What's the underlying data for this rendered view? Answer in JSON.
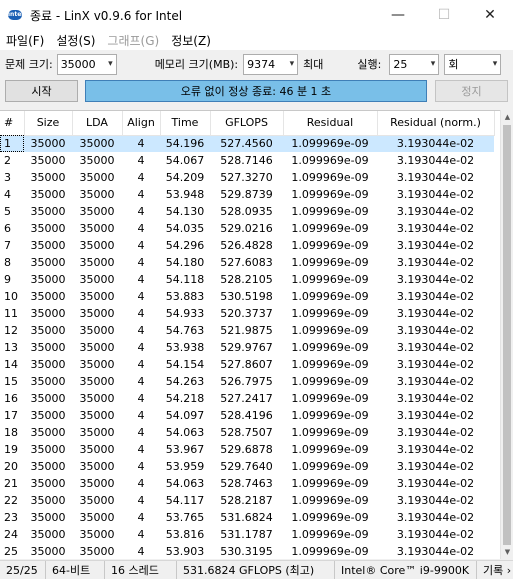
{
  "window": {
    "title": "종료 - LinX v0.9.6 for Intel",
    "app_icon_text": "intel",
    "minimize_glyph": "—",
    "maximize_glyph": "☐",
    "close_glyph": "✕"
  },
  "menu": {
    "file": "파일(F)",
    "settings": "설정(S)",
    "graph": "그래프(G)",
    "info": "정보(Z)"
  },
  "controls": {
    "problem_size_label": "문제 크기:",
    "problem_size_value": "35000",
    "memory_label": "메모리 크기(MB):",
    "memory_value": "9374",
    "max_label": "최대",
    "runs_label": "실행:",
    "runs_value": "25",
    "runs_unit": "회"
  },
  "actions": {
    "start_label": "시작",
    "status_text": "오류 없이 정상 종료: 46 분 1 초",
    "stop_label": "정지"
  },
  "table": {
    "columns": [
      "#",
      "Size",
      "LDA",
      "Align",
      "Time",
      "GFLOPS",
      "Residual",
      "Residual (norm.)"
    ],
    "rows": [
      [
        "1",
        "35000",
        "35000",
        "4",
        "54.196",
        "527.4560",
        "1.099969e-09",
        "3.193044e-02"
      ],
      [
        "2",
        "35000",
        "35000",
        "4",
        "54.067",
        "528.7146",
        "1.099969e-09",
        "3.193044e-02"
      ],
      [
        "3",
        "35000",
        "35000",
        "4",
        "54.209",
        "527.3270",
        "1.099969e-09",
        "3.193044e-02"
      ],
      [
        "4",
        "35000",
        "35000",
        "4",
        "53.948",
        "529.8739",
        "1.099969e-09",
        "3.193044e-02"
      ],
      [
        "5",
        "35000",
        "35000",
        "4",
        "54.130",
        "528.0935",
        "1.099969e-09",
        "3.193044e-02"
      ],
      [
        "6",
        "35000",
        "35000",
        "4",
        "54.035",
        "529.0216",
        "1.099969e-09",
        "3.193044e-02"
      ],
      [
        "7",
        "35000",
        "35000",
        "4",
        "54.296",
        "526.4828",
        "1.099969e-09",
        "3.193044e-02"
      ],
      [
        "8",
        "35000",
        "35000",
        "4",
        "54.180",
        "527.6083",
        "1.099969e-09",
        "3.193044e-02"
      ],
      [
        "9",
        "35000",
        "35000",
        "4",
        "54.118",
        "528.2105",
        "1.099969e-09",
        "3.193044e-02"
      ],
      [
        "10",
        "35000",
        "35000",
        "4",
        "53.883",
        "530.5198",
        "1.099969e-09",
        "3.193044e-02"
      ],
      [
        "11",
        "35000",
        "35000",
        "4",
        "54.933",
        "520.3737",
        "1.099969e-09",
        "3.193044e-02"
      ],
      [
        "12",
        "35000",
        "35000",
        "4",
        "54.763",
        "521.9875",
        "1.099969e-09",
        "3.193044e-02"
      ],
      [
        "13",
        "35000",
        "35000",
        "4",
        "53.938",
        "529.9767",
        "1.099969e-09",
        "3.193044e-02"
      ],
      [
        "14",
        "35000",
        "35000",
        "4",
        "54.154",
        "527.8607",
        "1.099969e-09",
        "3.193044e-02"
      ],
      [
        "15",
        "35000",
        "35000",
        "4",
        "54.263",
        "526.7975",
        "1.099969e-09",
        "3.193044e-02"
      ],
      [
        "16",
        "35000",
        "35000",
        "4",
        "54.218",
        "527.2417",
        "1.099969e-09",
        "3.193044e-02"
      ],
      [
        "17",
        "35000",
        "35000",
        "4",
        "54.097",
        "528.4196",
        "1.099969e-09",
        "3.193044e-02"
      ],
      [
        "18",
        "35000",
        "35000",
        "4",
        "54.063",
        "528.7507",
        "1.099969e-09",
        "3.193044e-02"
      ],
      [
        "19",
        "35000",
        "35000",
        "4",
        "53.967",
        "529.6878",
        "1.099969e-09",
        "3.193044e-02"
      ],
      [
        "20",
        "35000",
        "35000",
        "4",
        "53.959",
        "529.7640",
        "1.099969e-09",
        "3.193044e-02"
      ],
      [
        "21",
        "35000",
        "35000",
        "4",
        "54.063",
        "528.7463",
        "1.099969e-09",
        "3.193044e-02"
      ],
      [
        "22",
        "35000",
        "35000",
        "4",
        "54.117",
        "528.2187",
        "1.099969e-09",
        "3.193044e-02"
      ],
      [
        "23",
        "35000",
        "35000",
        "4",
        "53.765",
        "531.6824",
        "1.099969e-09",
        "3.193044e-02"
      ],
      [
        "24",
        "35000",
        "35000",
        "4",
        "53.816",
        "531.1787",
        "1.099969e-09",
        "3.193044e-02"
      ],
      [
        "25",
        "35000",
        "35000",
        "4",
        "53.903",
        "530.3195",
        "1.099969e-09",
        "3.193044e-02"
      ]
    ],
    "selected_row": "1"
  },
  "statusbar": {
    "progress": "25/25",
    "bits": "64-비트",
    "threads": "16 스레드",
    "peak": "531.6824 GFLOPS (최고)",
    "cpu": "Intel® Core™ i9-9900K",
    "log": "기록 ›"
  },
  "colors": {
    "status_fill": "#79bfe8",
    "selected_row": "#cce8ff"
  }
}
